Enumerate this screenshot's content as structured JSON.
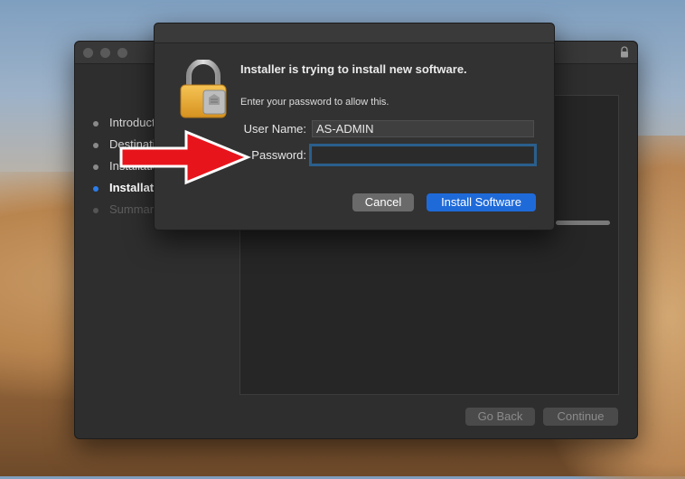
{
  "installer": {
    "steps": [
      {
        "label": "Introduction",
        "state": "done"
      },
      {
        "label": "Destination Select",
        "state": "done"
      },
      {
        "label": "Installation Type",
        "state": "done"
      },
      {
        "label": "Installation",
        "state": "active"
      },
      {
        "label": "Summary",
        "state": "pending"
      }
    ],
    "buttons": {
      "go_back": "Go Back",
      "continue": "Continue"
    }
  },
  "auth_dialog": {
    "title": "Installer is trying to install new software.",
    "message": "Enter your password to allow this.",
    "username_label": "User Name:",
    "username_value": "AS-ADMIN",
    "password_label": "Password:",
    "password_value": "",
    "cancel_label": "Cancel",
    "install_label": "Install Software"
  },
  "colors": {
    "accent": "#1f6ad9",
    "annotation_arrow": "#e8141c"
  }
}
